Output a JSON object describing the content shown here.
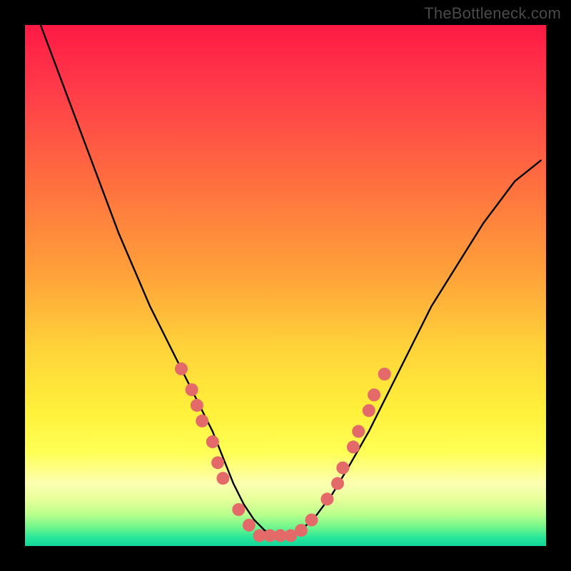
{
  "watermark": "TheBottleneck.com",
  "chart_data": {
    "type": "line",
    "title": "",
    "xlabel": "",
    "ylabel": "",
    "xlim": [
      0,
      100
    ],
    "ylim": [
      0,
      100
    ],
    "background_gradient": {
      "stops": [
        {
          "pos": 0.0,
          "color": "#ff1a44"
        },
        {
          "pos": 0.12,
          "color": "#ff3a4a"
        },
        {
          "pos": 0.3,
          "color": "#ff6e3f"
        },
        {
          "pos": 0.48,
          "color": "#ffa23a"
        },
        {
          "pos": 0.62,
          "color": "#ffd33a"
        },
        {
          "pos": 0.74,
          "color": "#fff03a"
        },
        {
          "pos": 0.82,
          "color": "#ffff55"
        },
        {
          "pos": 0.88,
          "color": "#fcffb0"
        },
        {
          "pos": 0.91,
          "color": "#e8ff9a"
        },
        {
          "pos": 0.94,
          "color": "#b8ff8c"
        },
        {
          "pos": 0.965,
          "color": "#6cf58c"
        },
        {
          "pos": 0.985,
          "color": "#25e59a"
        },
        {
          "pos": 1.0,
          "color": "#12d69a"
        }
      ]
    },
    "series": [
      {
        "name": "bottleneck-curve",
        "color": "#000000",
        "x": [
          3,
          6,
          9,
          12,
          15,
          18,
          21,
          24,
          27,
          30,
          33,
          36,
          38,
          40,
          42,
          44,
          46,
          48,
          50,
          53,
          56,
          59,
          62,
          66,
          70,
          74,
          78,
          83,
          88,
          94,
          99
        ],
        "y": [
          100,
          92,
          84,
          76,
          68,
          60,
          53,
          46,
          40,
          34,
          28,
          22,
          17,
          12,
          8,
          5,
          3,
          2,
          2,
          3,
          6,
          10,
          15,
          22,
          30,
          38,
          46,
          54,
          62,
          70,
          74
        ]
      }
    ],
    "markers": {
      "name": "data-points",
      "color": "#e46a6a",
      "radius_px": 9,
      "points": [
        {
          "x": 30,
          "y": 34
        },
        {
          "x": 32,
          "y": 30
        },
        {
          "x": 33,
          "y": 27
        },
        {
          "x": 34,
          "y": 24
        },
        {
          "x": 36,
          "y": 20
        },
        {
          "x": 37,
          "y": 16
        },
        {
          "x": 38,
          "y": 13
        },
        {
          "x": 41,
          "y": 7
        },
        {
          "x": 43,
          "y": 4
        },
        {
          "x": 45,
          "y": 2
        },
        {
          "x": 47,
          "y": 2
        },
        {
          "x": 49,
          "y": 2
        },
        {
          "x": 51,
          "y": 2
        },
        {
          "x": 53,
          "y": 3
        },
        {
          "x": 55,
          "y": 5
        },
        {
          "x": 58,
          "y": 9
        },
        {
          "x": 60,
          "y": 12
        },
        {
          "x": 61,
          "y": 15
        },
        {
          "x": 63,
          "y": 19
        },
        {
          "x": 64,
          "y": 22
        },
        {
          "x": 66,
          "y": 26
        },
        {
          "x": 67,
          "y": 29
        },
        {
          "x": 69,
          "y": 33
        }
      ]
    }
  }
}
